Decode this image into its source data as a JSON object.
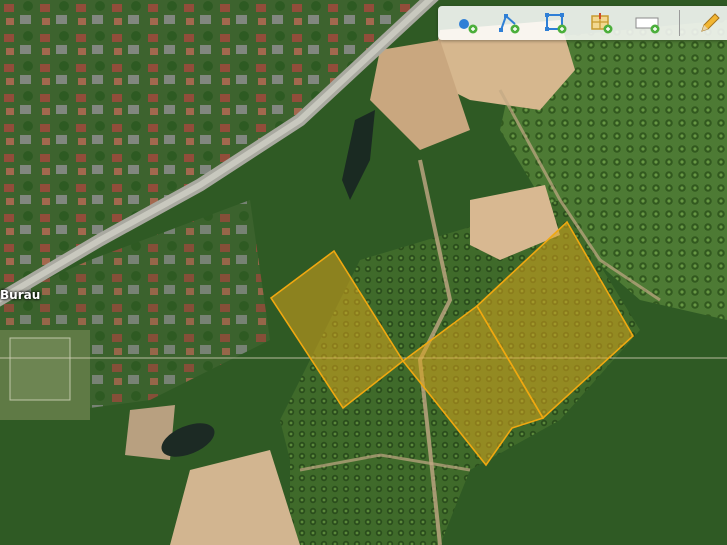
{
  "map": {
    "place_label": "Burau"
  },
  "parcels": [
    {
      "id": "parcel-1"
    },
    {
      "id": "parcel-2"
    },
    {
      "id": "parcel-3"
    }
  ],
  "toolbar": {
    "tools": [
      {
        "name": "add-point-tool",
        "icon": "point-icon"
      },
      {
        "name": "add-line-tool",
        "icon": "polyline-icon"
      },
      {
        "name": "add-polygon-tool",
        "icon": "polygon-icon"
      },
      {
        "name": "add-parcel-tool",
        "icon": "parcel-icon"
      },
      {
        "name": "add-label-tool",
        "icon": "label-box-icon"
      },
      {
        "name": "edit-tool",
        "icon": "pencil-icon"
      }
    ]
  },
  "colors": {
    "parcel_fill": "#d9a41c",
    "parcel_stroke": "#f0a810",
    "tool_blue": "#2f7fd6",
    "tool_green": "#4caf3c"
  }
}
